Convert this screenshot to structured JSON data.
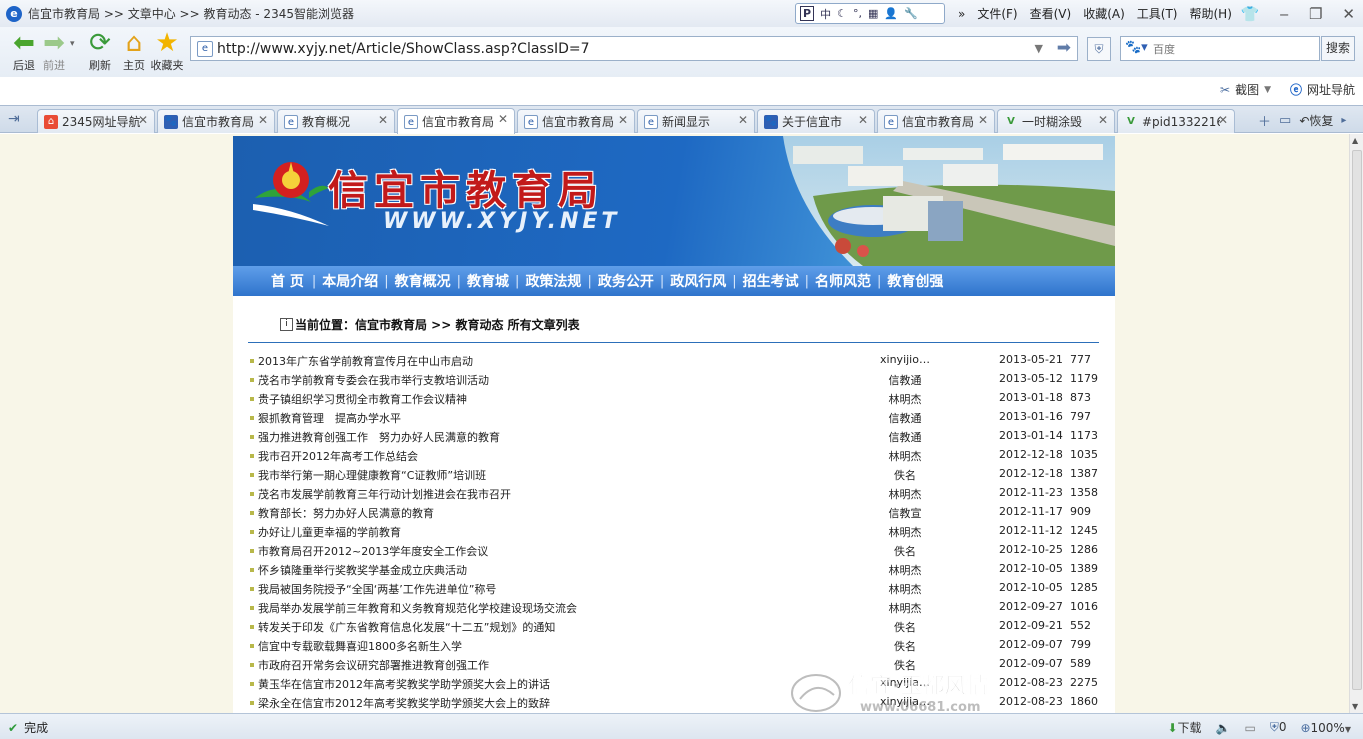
{
  "window": {
    "title": "信宜市教育局 >> 文章中心 >> 教育动态 - 2345智能浏览器",
    "tools": [
      "P",
      "中",
      "☾",
      "°,",
      "▦",
      "👤",
      "🔧"
    ],
    "menus": [
      "文件(F)",
      "查看(V)",
      "收藏(A)",
      "工具(T)",
      "帮助(H)"
    ]
  },
  "toolbar": {
    "back_label": "后退",
    "forward_label": "前进",
    "refresh_label": "刷新",
    "home_label": "主页",
    "favorites_label": "收藏夹",
    "url": "http://www.xyjy.net/Article/ShowClass.asp?ClassID=7",
    "search_placeholder": "百度",
    "search_button": "搜索",
    "screenshot_label": "截图",
    "url_nav_label": "网址导航"
  },
  "tabs": [
    {
      "label": "2345网址导航",
      "favicon": "2345-icon"
    },
    {
      "label": "信宜市教育局",
      "favicon": "paw-icon"
    },
    {
      "label": "教育概况",
      "favicon": "ie-page-icon"
    },
    {
      "label": "信宜市教育局",
      "favicon": "ie-page-icon",
      "active": true
    },
    {
      "label": "信宜市教育局",
      "favicon": "ie-page-icon"
    },
    {
      "label": "新闻显示",
      "favicon": "ie-page-icon"
    },
    {
      "label": "关于信宜市",
      "favicon": "paw-icon"
    },
    {
      "label": "信宜市教育局",
      "favicon": "ie-page-icon"
    },
    {
      "label": "一时糊涂毁",
      "favicon": "v-icon"
    },
    {
      "label": "#pid1332216",
      "favicon": "v-icon"
    }
  ],
  "tab_tail": {
    "restore_label": "恢复"
  },
  "site": {
    "name": "信宜市教育局",
    "url_text": "WWW.XYJY.NET",
    "nav": [
      "首 页",
      "本局介绍",
      "教育概况",
      "教育城",
      "政策法规",
      "政务公开",
      "政风行风",
      "招生考试",
      "名师风范",
      "教育创强"
    ],
    "breadcrumb": "当前位置：信宜市教育局 >> 教育动态  所有文章列表",
    "articles": [
      {
        "title": "2013年广东省学前教育宣传月在中山市启动",
        "author": "xinyijio…",
        "date": "2013-05-21",
        "hits": "777"
      },
      {
        "title": "茂名市学前教育专委会在我市举行支教培训活动",
        "author": "信教通",
        "date": "2013-05-12",
        "hits": "1179"
      },
      {
        "title": "贵子镇组织学习贯彻全市教育工作会议精神",
        "author": "林明杰",
        "date": "2013-01-18",
        "hits": "873"
      },
      {
        "title": "狠抓教育管理　提高办学水平",
        "author": "信教通",
        "date": "2013-01-16",
        "hits": "797"
      },
      {
        "title": "强力推进教育创强工作　努力办好人民满意的教育",
        "author": "信教通",
        "date": "2013-01-14",
        "hits": "1173"
      },
      {
        "title": "我市召开2012年高考工作总结会",
        "author": "林明杰",
        "date": "2012-12-18",
        "hits": "1035"
      },
      {
        "title": "我市举行第一期心理健康教育“C证教师”培训班",
        "author": "佚名",
        "date": "2012-12-18",
        "hits": "1387"
      },
      {
        "title": "茂名市发展学前教育三年行动计划推进会在我市召开",
        "author": "林明杰",
        "date": "2012-11-23",
        "hits": "1358"
      },
      {
        "title": "教育部长：努力办好人民满意的教育",
        "author": "信教宣",
        "date": "2012-11-17",
        "hits": "909"
      },
      {
        "title": "办好让儿童更幸福的学前教育",
        "author": "林明杰",
        "date": "2012-11-12",
        "hits": "1245"
      },
      {
        "title": "市教育局召开2012~2013学年度安全工作会议",
        "author": "佚名",
        "date": "2012-10-25",
        "hits": "1286"
      },
      {
        "title": "怀乡镇隆重举行奖教奖学基金成立庆典活动",
        "author": "林明杰",
        "date": "2012-10-05",
        "hits": "1389"
      },
      {
        "title": "我局被国务院授予“全国‘两基’工作先进单位”称号",
        "author": "林明杰",
        "date": "2012-10-05",
        "hits": "1285"
      },
      {
        "title": "我局举办发展学前三年教育和义务教育规范化学校建设现场交流会",
        "author": "林明杰",
        "date": "2012-09-27",
        "hits": "1016"
      },
      {
        "title": "转发关于印发《广东省教育信息化发展“十二五”规划》的通知",
        "author": "佚名",
        "date": "2012-09-21",
        "hits": "552"
      },
      {
        "title": "信宜中专载歌载舞喜迎1800多名新生入学",
        "author": "佚名",
        "date": "2012-09-07",
        "hits": "799"
      },
      {
        "title": "市政府召开常务会议研究部署推进教育创强工作",
        "author": "佚名",
        "date": "2012-09-07",
        "hits": "589"
      },
      {
        "title": "黄玉华在信宜市2012年高考奖教奖学助学颁奖大会上的讲话",
        "author": "xinyijia…",
        "date": "2012-08-23",
        "hits": "2275"
      },
      {
        "title": "梁永全在信宜市2012年高考奖教奖学助学颁奖大会上的致辞",
        "author": "xinyijia…",
        "date": "2012-08-23",
        "hits": "1860"
      }
    ],
    "watermark_name": "信宜·玉都风情",
    "watermark_url": "www.06681.com"
  },
  "status": {
    "done": "完成",
    "download": "下载",
    "shield_count": "0",
    "zoom": "100%"
  },
  "colors": {
    "accent": "#1e64c8",
    "nav_blue": "#2f74cc",
    "page_bg": "#f8f6e8",
    "title_red": "#c21a1a"
  }
}
